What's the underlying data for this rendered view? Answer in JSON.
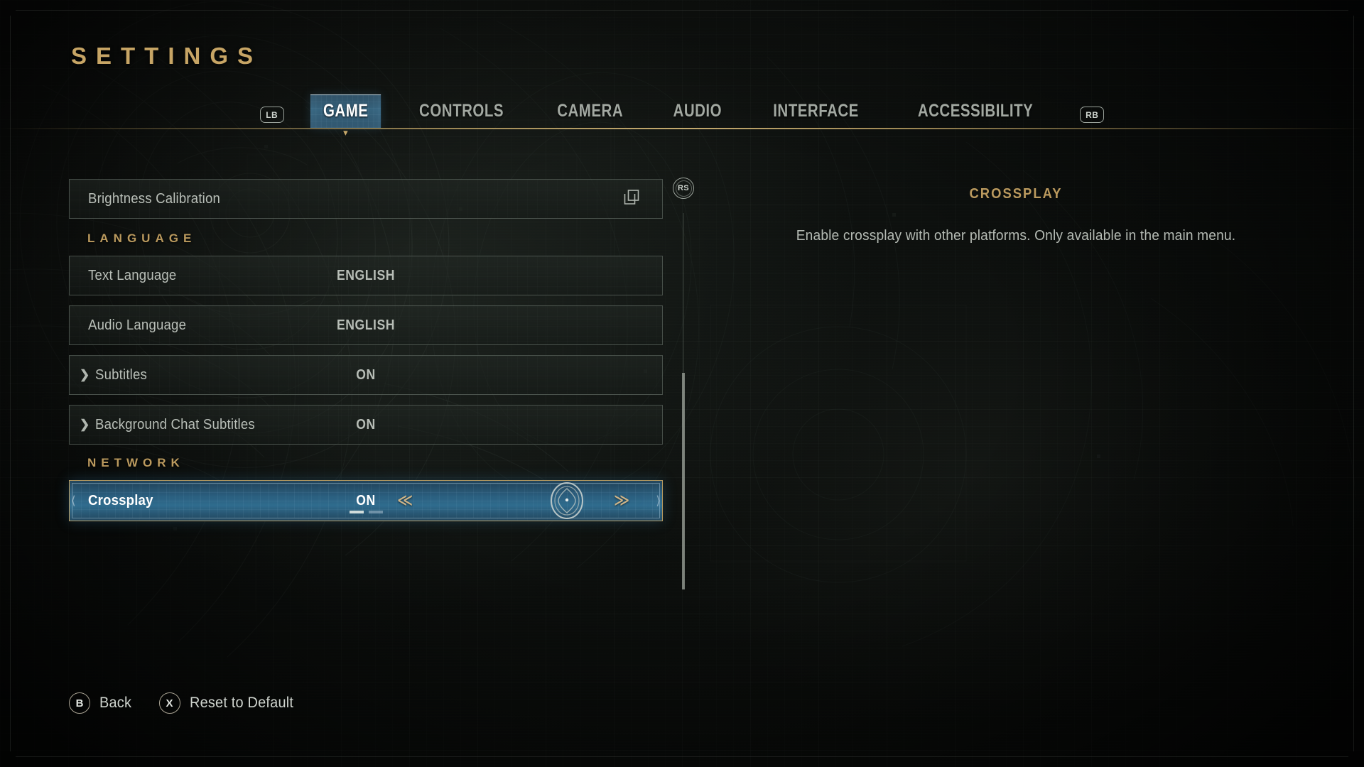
{
  "page_title": "SETTINGS",
  "accent_gold": "#bb9a5e",
  "accent_blue": "#2f6b8d",
  "tabs": {
    "left_bumper": "LB",
    "right_bumper": "RB",
    "items": [
      {
        "label": "GAME",
        "active": true
      },
      {
        "label": "CONTROLS",
        "active": false
      },
      {
        "label": "CAMERA",
        "active": false
      },
      {
        "label": "AUDIO",
        "active": false
      },
      {
        "label": "INTERFACE",
        "active": false
      },
      {
        "label": "ACCESSIBILITY",
        "active": false
      }
    ]
  },
  "list": {
    "brightness": {
      "label": "Brightness Calibration",
      "icon": "duplicate-icon"
    },
    "section_language": "LANGUAGE",
    "text_language": {
      "label": "Text Language",
      "value": "ENGLISH"
    },
    "audio_language": {
      "label": "Audio Language",
      "value": "ENGLISH"
    },
    "subtitles": {
      "chevron": "❯",
      "label": "Subtitles",
      "value": "ON"
    },
    "background_chat_subtitles": {
      "chevron": "❯",
      "label": "Background Chat Subtitles",
      "value": "ON"
    },
    "section_network": "NETWORK",
    "crossplay": {
      "label": "Crossplay",
      "value": "ON",
      "left_arrow": "≪",
      "right_arrow": "≫",
      "edge_left": "⟨",
      "edge_right": "⟩"
    }
  },
  "scroll": {
    "stick_hint": "RS"
  },
  "description": {
    "title": "CROSSPLAY",
    "body": "Enable crossplay with other platforms. Only available in the main menu."
  },
  "footer": {
    "buttons": [
      {
        "glyph": "B",
        "label": "Back"
      },
      {
        "glyph": "X",
        "label": "Reset to Default"
      }
    ]
  }
}
